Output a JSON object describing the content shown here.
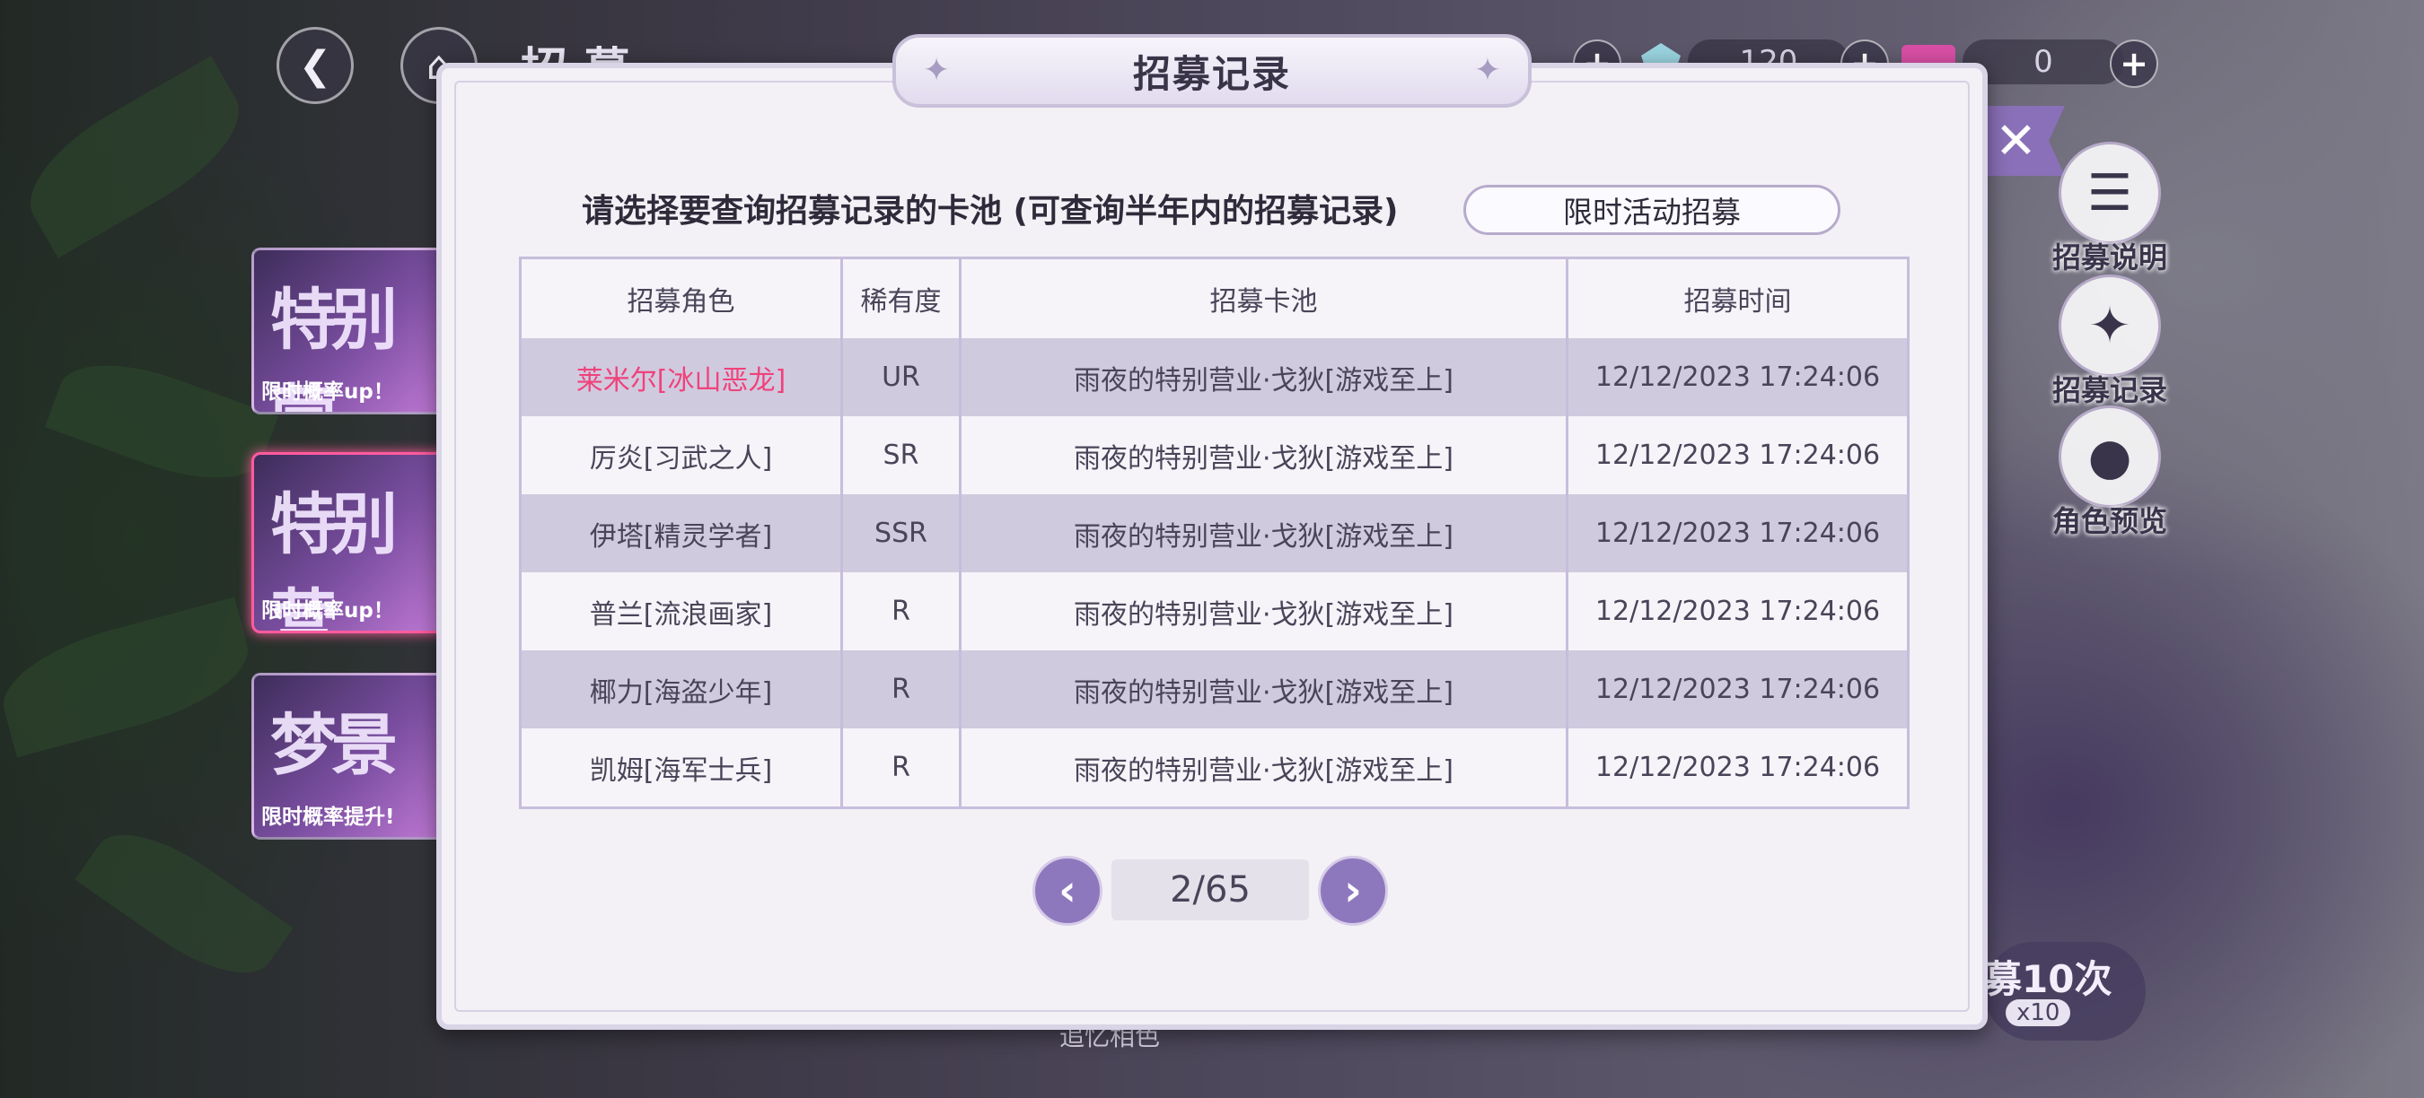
{
  "top_bar": {
    "back_icon": "back-arrow-icon",
    "home_icon": "home-icon",
    "title": "招 募",
    "currency_gem": "120",
    "currency_ticket": "0"
  },
  "banners": [
    {
      "art": "特别营",
      "tag": "限时概率up！"
    },
    {
      "art": "特别营",
      "tag": "限时概率up！"
    },
    {
      "art": "梦景",
      "tag": "限时概率提升!"
    }
  ],
  "side_menu": [
    {
      "label": "招募说明",
      "icon": "clipboard-icon"
    },
    {
      "label": "招募记录",
      "icon": "cards-icon"
    },
    {
      "label": "角色预览",
      "icon": "person-icon"
    }
  ],
  "recruit10": {
    "label": "募10次",
    "cost": "x10"
  },
  "bottom_snippet": "追忆相色",
  "dialog": {
    "title": "招募记录",
    "prompt": "请选择要查询招募记录的卡池 (可查询半年内的招募记录)",
    "pool_select": "限时活动招募",
    "columns": [
      "招募角色",
      "稀有度",
      "招募卡池",
      "招募时间"
    ],
    "rows": [
      {
        "name": "莱米尔[冰山恶龙]",
        "rarity": "UR",
        "pool": "雨夜的特别营业·戈狄[游戏至上]",
        "time": "12/12/2023 17:24:06"
      },
      {
        "name": "厉炎[习武之人]",
        "rarity": "SR",
        "pool": "雨夜的特别营业·戈狄[游戏至上]",
        "time": "12/12/2023 17:24:06"
      },
      {
        "name": "伊塔[精灵学者]",
        "rarity": "SSR",
        "pool": "雨夜的特别营业·戈狄[游戏至上]",
        "time": "12/12/2023 17:24:06"
      },
      {
        "name": "普兰[流浪画家]",
        "rarity": "R",
        "pool": "雨夜的特别营业·戈狄[游戏至上]",
        "time": "12/12/2023 17:24:06"
      },
      {
        "name": "椰力[海盗少年]",
        "rarity": "R",
        "pool": "雨夜的特别营业·戈狄[游戏至上]",
        "time": "12/12/2023 17:24:06"
      },
      {
        "name": "凯姆[海军士兵]",
        "rarity": "R",
        "pool": "雨夜的特别营业·戈狄[游戏至上]",
        "time": "12/12/2023 17:24:06"
      }
    ],
    "pager": {
      "page": "2/65"
    }
  },
  "colors": {
    "ur_highlight": "#f0427a",
    "accent": "#8e78bd",
    "row_shade": "#d0cadf"
  }
}
